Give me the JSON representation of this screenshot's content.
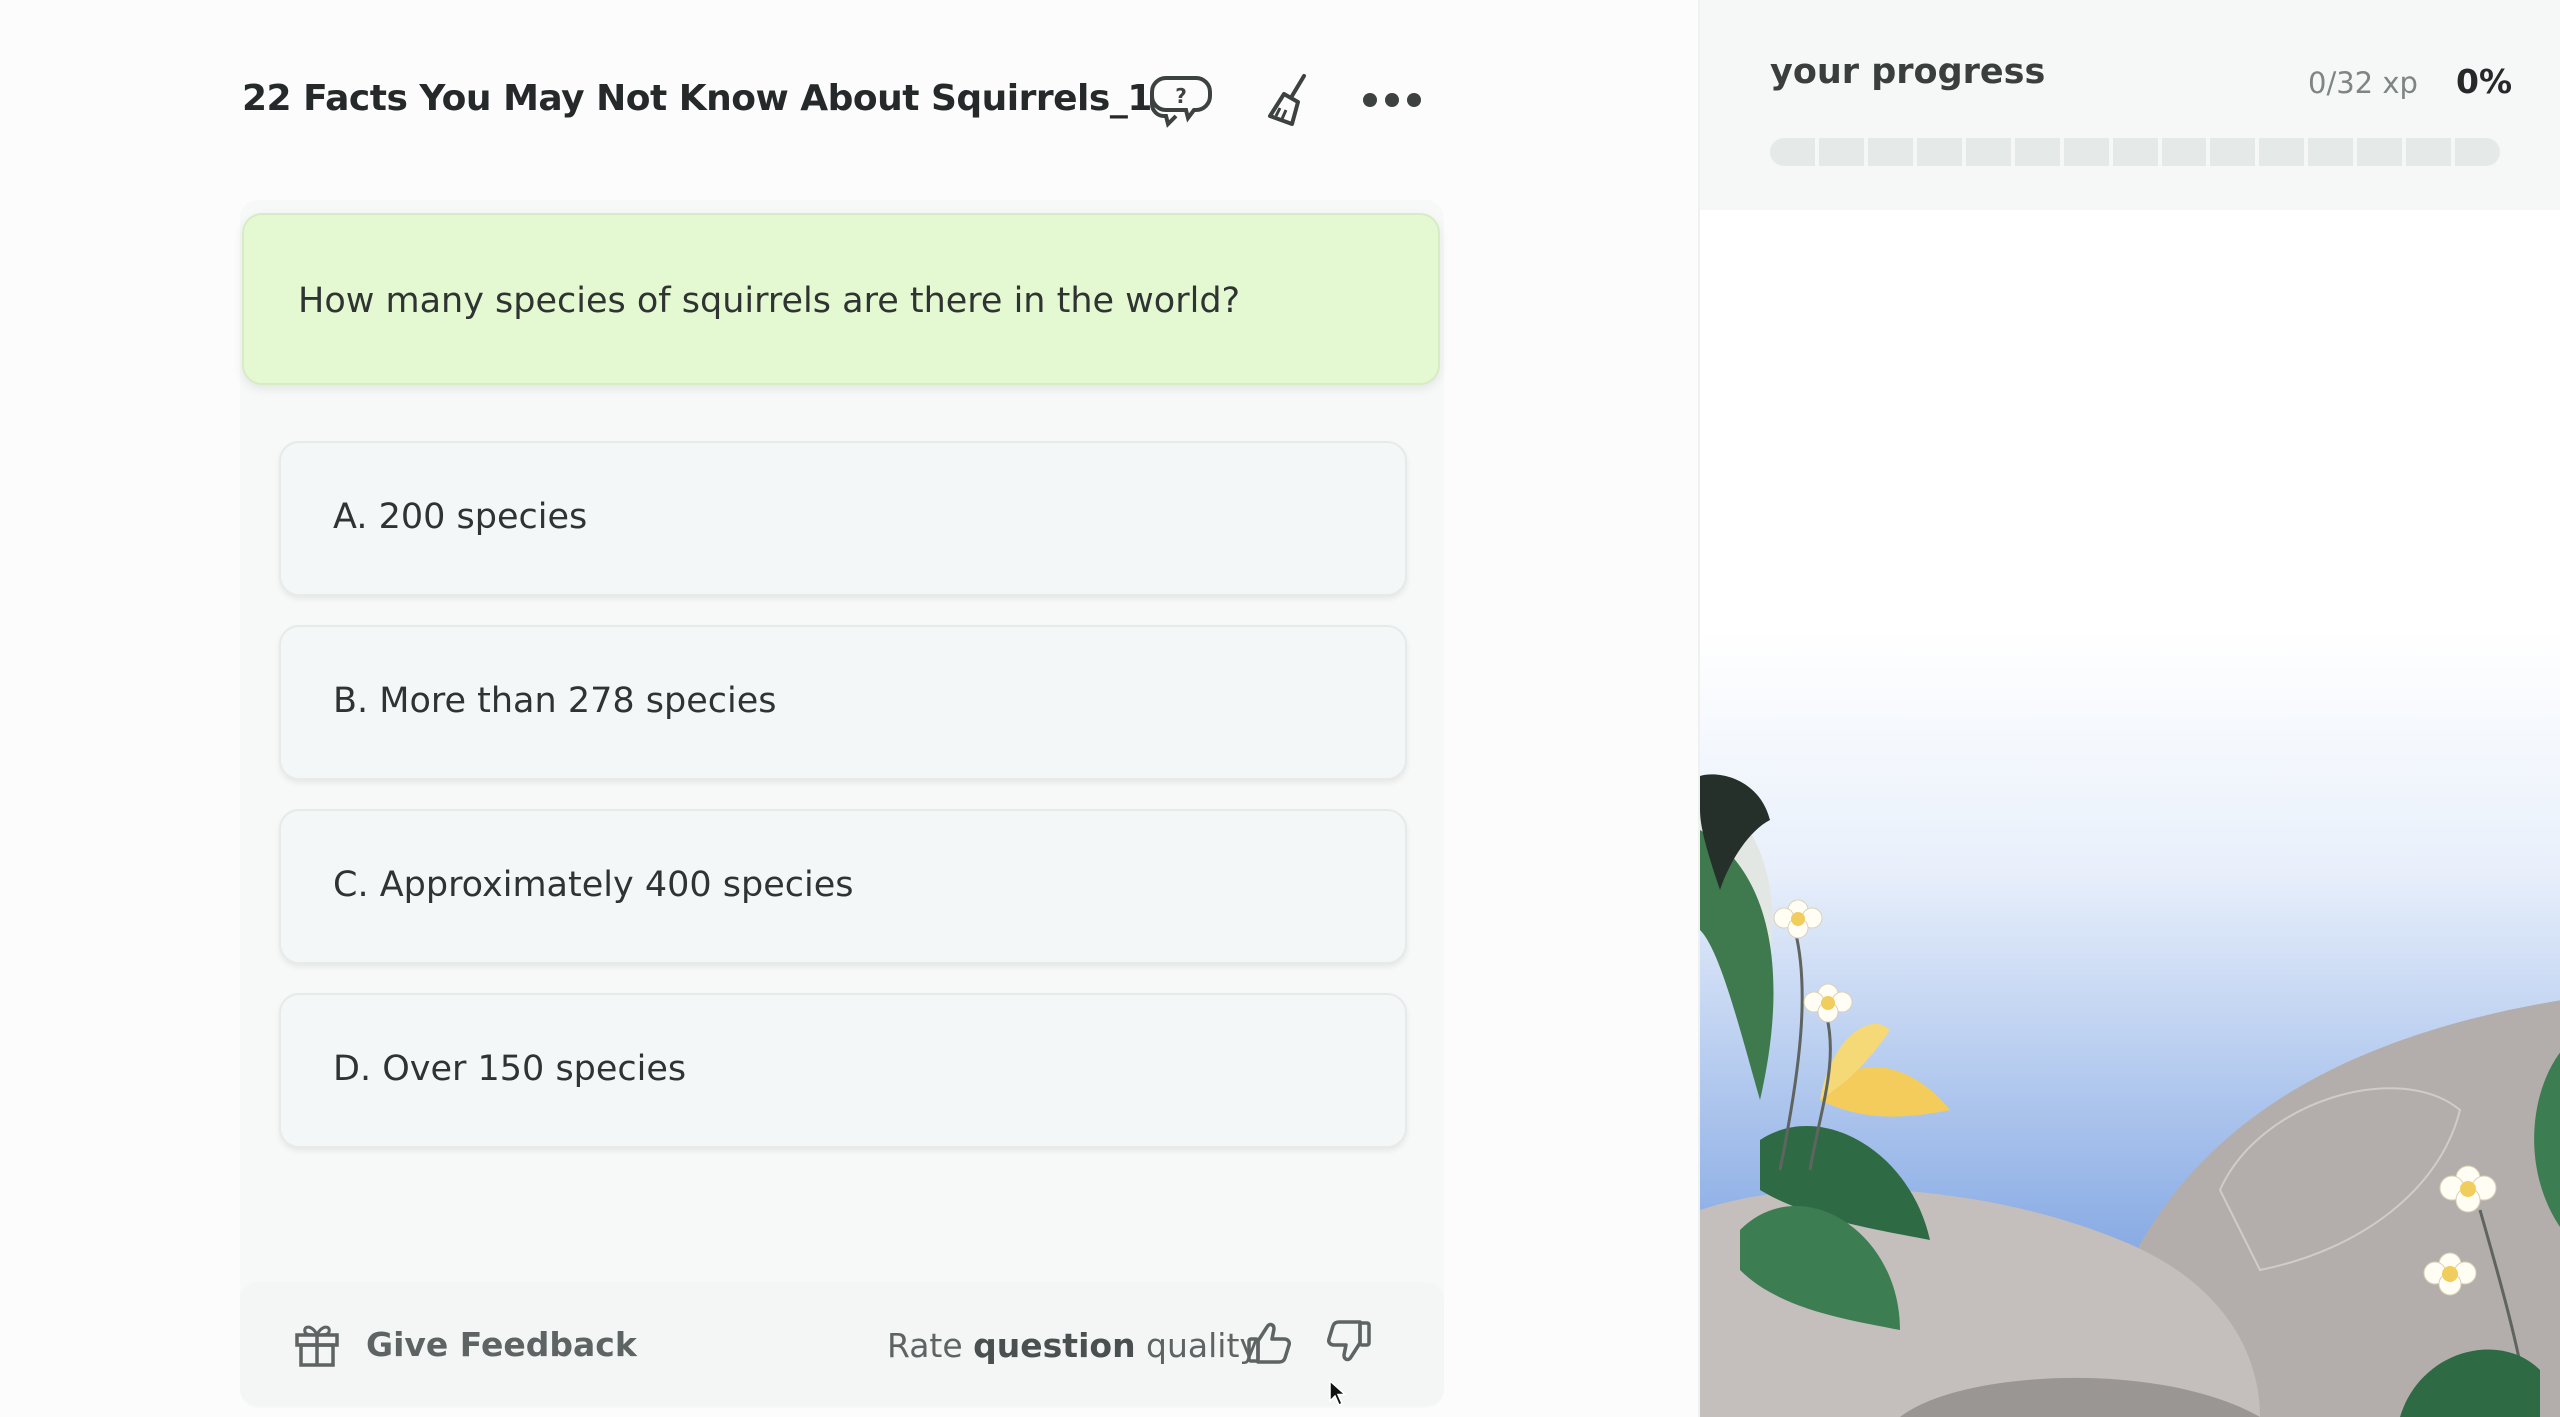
{
  "header": {
    "title": "22 Facts You May Not Know About Squirrels_1"
  },
  "question": {
    "text": "How many species of squirrels are there in the world?"
  },
  "options": [
    {
      "label": "A. 200 species"
    },
    {
      "label": "B. More than 278 species"
    },
    {
      "label": "C. Approximately 400 species"
    },
    {
      "label": "D. Over 150 species"
    }
  ],
  "footer": {
    "feedback_label": "Give Feedback",
    "rate_prefix": "Rate ",
    "rate_bold": "question",
    "rate_suffix": " quality"
  },
  "progress": {
    "title": "your progress",
    "xp": "0/32 xp",
    "percent": "0%",
    "fraction": 0
  },
  "icons": {
    "help": "help-chat-icon",
    "clear": "broom-icon",
    "more": "more-dots-icon",
    "gift": "gift-icon",
    "thumbs_up": "thumbs-up-icon",
    "thumbs_down": "thumbs-down-icon"
  },
  "colors": {
    "question_bg": "#e4f9d2",
    "option_bg": "#f4f7f7",
    "progress_track": "#e5e9e8"
  }
}
